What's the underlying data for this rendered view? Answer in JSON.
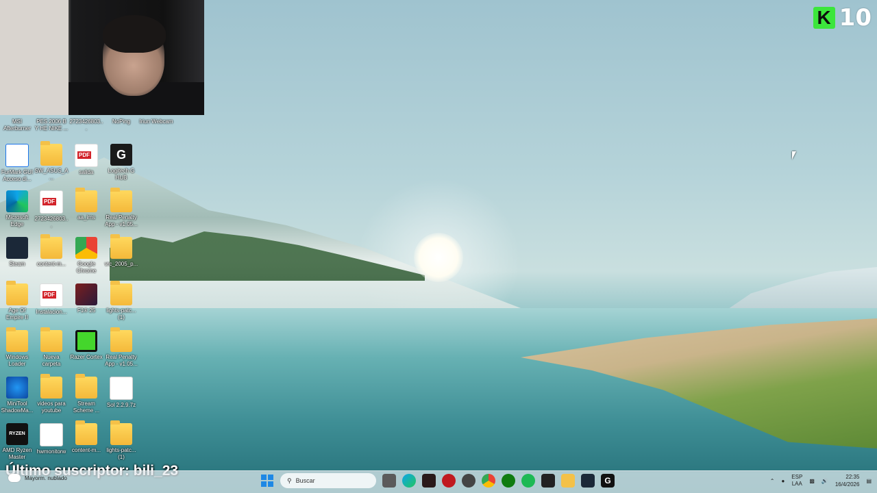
{
  "brand": {
    "letter": "K",
    "number": "10"
  },
  "subscriber_text": "Último suscriptor: bili_23",
  "desktop_icons": [
    {
      "label": "MSI Afterburner"
    },
    {
      "label": "PES 2006 B Y HE NIKE ..."
    },
    {
      "label": "2723426803..."
    },
    {
      "label": "NoPing"
    },
    {
      "label": "Iriun Webcam"
    },
    {
      "label": "FurMark GUI Acceso di..."
    },
    {
      "label": "SW_ASUS_A..."
    },
    {
      "label": "salida"
    },
    {
      "label": "Logitech G HUB"
    },
    {
      "label": "Microsoft Edge"
    },
    {
      "label": "2723426803..."
    },
    {
      "label": "aa_ims"
    },
    {
      "label": "Real Penalty App - v1.05..."
    },
    {
      "label": "Steam"
    },
    {
      "label": "content-m..."
    },
    {
      "label": "Google Chrome"
    },
    {
      "label": "vrc_2005_p..."
    },
    {
      "label": "Age Of Empire II"
    },
    {
      "label": "Instalacion..."
    },
    {
      "label": "F1® 25"
    },
    {
      "label": "lights-patc... (1)"
    },
    {
      "label": "Windows Loader"
    },
    {
      "label": "Nueva carpeta"
    },
    {
      "label": "Razer Cortex"
    },
    {
      "label": "Real Penalty App - v1.05..."
    },
    {
      "label": "MiniTool ShadowMa..."
    },
    {
      "label": "videos para youtube"
    },
    {
      "label": "Stream Scheme ..."
    },
    {
      "label": "Sol 2.2.9.7z"
    },
    {
      "label": "AMD Ryzen Master"
    },
    {
      "label": "hwmonitorw"
    },
    {
      "label": "content-m..."
    },
    {
      "label": "lights-patc... (1)"
    }
  ],
  "taskbar": {
    "weather": "Mayorm. nublado",
    "search_placeholder": "Buscar",
    "lang_top": "ESP",
    "lang_bottom": "LAA",
    "time": "22:35",
    "date": "16/4/2026"
  },
  "colors": {
    "brand_green": "#3ce63c",
    "pdf_red": "#d2232a",
    "folder_yellow": "#f4b93a"
  }
}
